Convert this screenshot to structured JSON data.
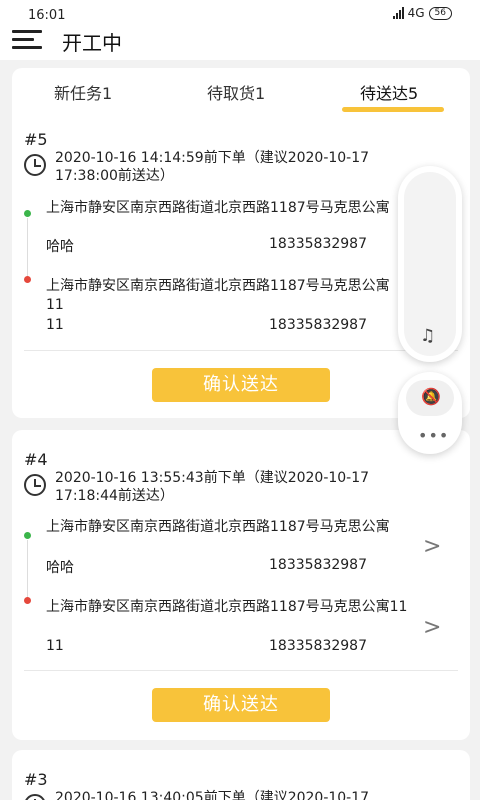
{
  "status_bar": {
    "time": "16:01",
    "network": "4G",
    "battery": "56"
  },
  "header": {
    "title": "开工中",
    "menu_icon": "hamburger-menu-icon"
  },
  "tabs": [
    {
      "label": "新任务1",
      "active": false
    },
    {
      "label": "待取货1",
      "active": false
    },
    {
      "label": "待送达5",
      "active": true
    }
  ],
  "accent_color": "#f8c33a",
  "orders": [
    {
      "number": "#5",
      "time_line1": "2020-10-16 14:14:59前下单（建议2020-10-17",
      "time_line2": "17:38:00前送达）",
      "pickup": {
        "address": "上海市静安区南京西路街道北京西路1187号马克思公寓",
        "name": "哈哈",
        "phone": "18335832987"
      },
      "delivery": {
        "address": "上海市静安区南京西路街道北京西路1187号马克思公寓11",
        "name": "11",
        "phone": "18335832987"
      },
      "button": "确认送达"
    },
    {
      "number": "#4",
      "time_line1": "2020-10-16 13:55:43前下单（建议2020-10-17",
      "time_line2": "17:18:44前送达）",
      "pickup": {
        "address": "上海市静安区南京西路街道北京西路1187号马克思公寓",
        "name": "哈哈",
        "phone": "18335832987"
      },
      "delivery": {
        "address": "上海市静安区南京西路街道北京西路1187号马克思公寓11",
        "name": "11",
        "phone": "18335832987"
      },
      "button": "确认送达"
    },
    {
      "number": "#3",
      "time_line1": "2020-10-16 13:40:05前下单（建议2020-10-17"
    }
  ],
  "floating": {
    "music_icon": "music-note-icon",
    "bell_icon": "bell-off-icon",
    "more_icon": "more-dots-icon"
  }
}
